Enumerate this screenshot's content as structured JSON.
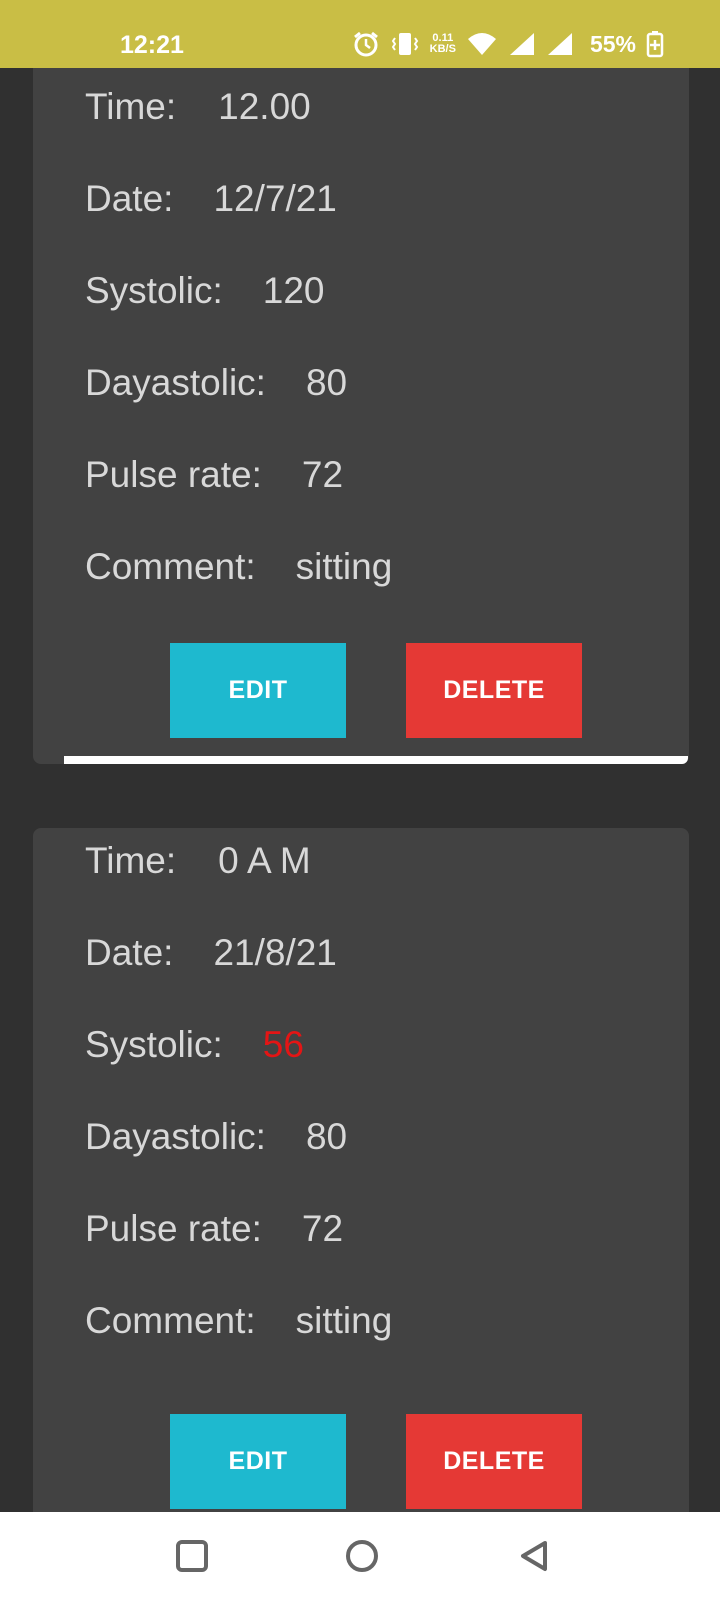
{
  "status_bar": {
    "time": "12:21",
    "net_speed_value": "0.11",
    "net_speed_unit": "KB/S",
    "battery": "55%",
    "icons": [
      "alarm-icon",
      "vibrate-icon",
      "wifi-icon",
      "signal-icon",
      "signal-icon",
      "battery-charging-icon"
    ]
  },
  "records": [
    {
      "time_label": "Time:",
      "time_value": "12.00",
      "date_label": "Date:",
      "date_value": "12/7/21",
      "systolic_label": "Systolic:",
      "systolic_value": "120",
      "diastolic_label": "Dayastolic:",
      "diastolic_value": "80",
      "pulse_label": "Pulse rate:",
      "pulse_value": "72",
      "comment_label": "Comment:",
      "comment_value": "sitting",
      "edit_label": "EDIT",
      "delete_label": "DELETE"
    },
    {
      "time_label": "Time:",
      "time_value": "0 A M",
      "date_label": "Date:",
      "date_value": "21/8/21",
      "systolic_label": "Systolic:",
      "systolic_value": "56",
      "diastolic_label": "Dayastolic:",
      "diastolic_value": "80",
      "pulse_label": "Pulse rate:",
      "pulse_value": "72",
      "comment_label": "Comment:",
      "comment_value": "sitting",
      "edit_label": "EDIT",
      "delete_label": "DELETE"
    }
  ],
  "colors": {
    "status_bar": "#c9be45",
    "background": "#303030",
    "card": "#424242",
    "edit_button": "#1eb9cf",
    "delete_button": "#e53935",
    "alert_value": "#e41515"
  },
  "nav_bar": {
    "icons": [
      "recents-square-icon",
      "home-circle-icon",
      "back-triangle-icon"
    ]
  }
}
